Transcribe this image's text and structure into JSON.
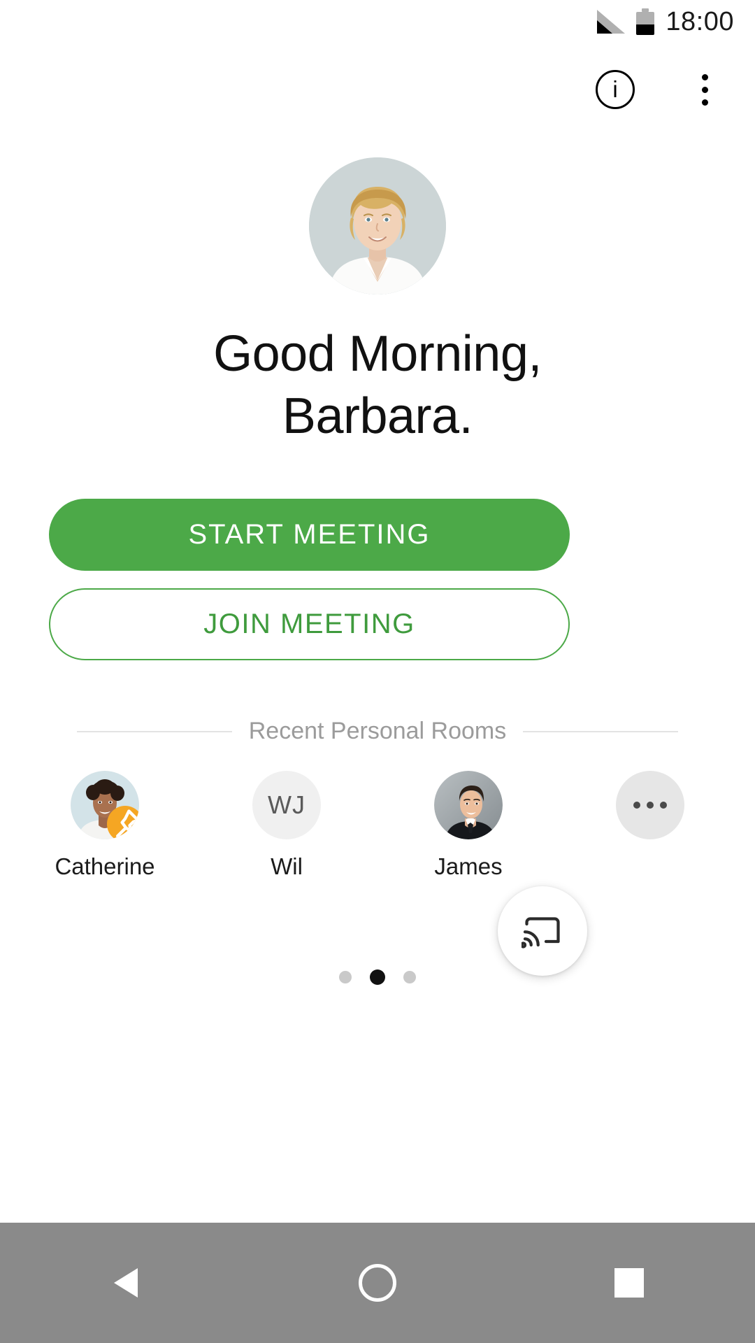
{
  "status_bar": {
    "time": "18:00",
    "signal_icon": "signal-bars-icon",
    "battery_icon": "battery-icon"
  },
  "app_bar": {
    "info_icon": "info-circle-icon",
    "info_glyph": "i",
    "overflow_icon": "kebab-menu-icon"
  },
  "profile": {
    "avatar_alt": "user-avatar-photo"
  },
  "greeting": {
    "line1": "Good Morning,",
    "line2": "Barbara."
  },
  "actions": {
    "start_meeting": "START MEETING",
    "join_meeting": "JOIN MEETING"
  },
  "recent_section": {
    "title": "Recent Personal Rooms"
  },
  "recent_rooms": [
    {
      "name": "Catherine",
      "avatar_type": "photo",
      "initials": "",
      "pinned": true
    },
    {
      "name": "Wil",
      "avatar_type": "initials",
      "initials": "WJ",
      "pinned": false
    },
    {
      "name": "James",
      "avatar_type": "photo",
      "initials": "",
      "pinned": false
    },
    {
      "name": "",
      "avatar_type": "more",
      "initials": "",
      "pinned": false
    }
  ],
  "pagination": {
    "total": 3,
    "active_index": 1
  },
  "cast_button": {
    "icon": "screen-cast-icon"
  },
  "nav_bar": {
    "back": "back-icon",
    "home": "home-icon",
    "recents": "recents-icon"
  },
  "colors": {
    "primary_green": "#4CA948",
    "join_text_green": "#3f9b3d",
    "pin_orange": "#F5A623",
    "section_label_gray": "#9b9b9b",
    "nav_bar_gray": "#8a8a8a"
  }
}
